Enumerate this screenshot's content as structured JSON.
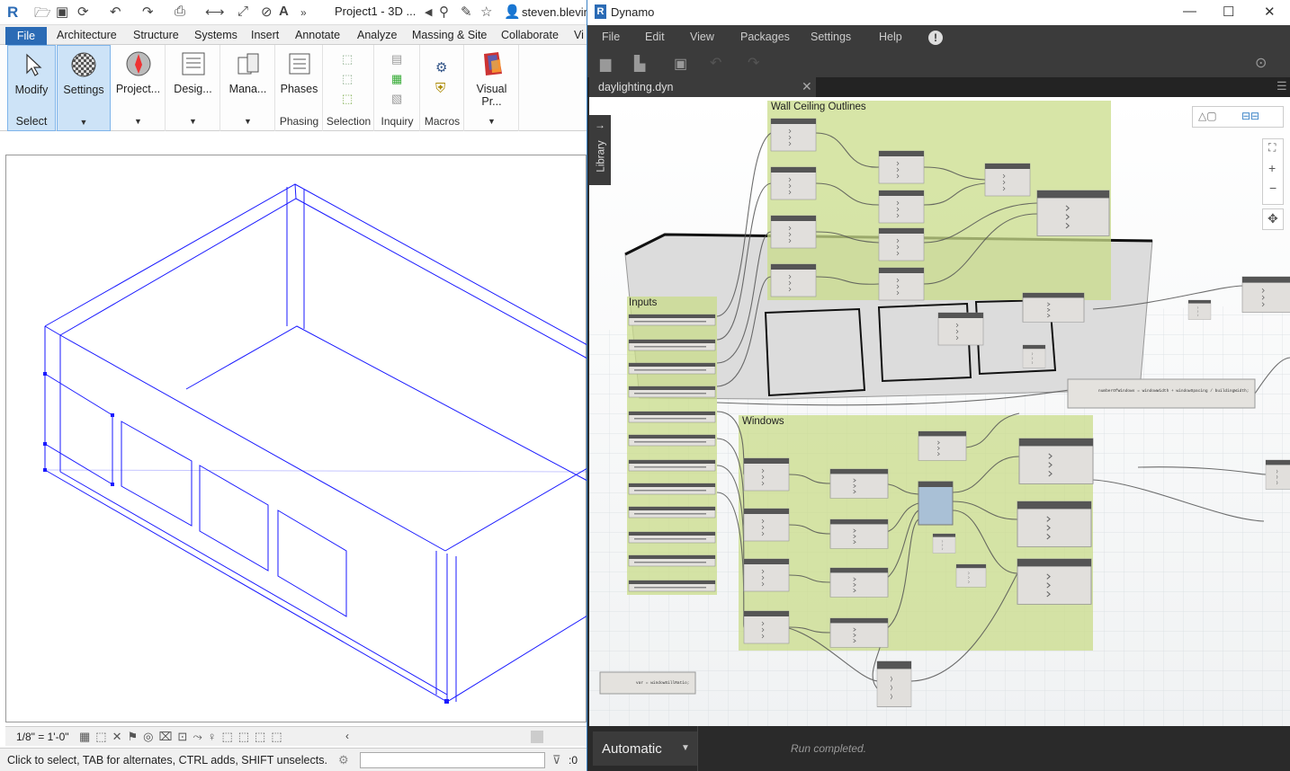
{
  "revit": {
    "window_title": "Project1 - 3D ...",
    "user": "steven.blevin",
    "tabs": [
      "File",
      "Architecture",
      "Structure",
      "Systems",
      "Insert",
      "Annotate",
      "Analyze",
      "Massing & Site",
      "Collaborate",
      "Vi"
    ],
    "ribbon": {
      "modify": "Modify",
      "select_panel": "Select",
      "settings": "Settings",
      "project": "Project...",
      "design": "Desig...",
      "manage": "Mana...",
      "phases": "Phases",
      "phasing_panel": "Phasing",
      "selection_panel": "Selection",
      "inquiry_panel": "Inquiry",
      "macros_panel": "Macros",
      "visual": "Visual Pr..."
    },
    "view_scale": "1/8\" = 1'-0\"",
    "status_text": "Click to select, TAB for alternates, CTRL adds, SHIFT unselects.",
    "filter_count": ":0"
  },
  "dynamo": {
    "title": "Dynamo",
    "menu": [
      "File",
      "Edit",
      "View",
      "Packages",
      "Settings",
      "Help"
    ],
    "tab_name": "daylighting.dyn",
    "library_label": "Library",
    "groups": {
      "wall": "Wall Ceiling Outlines",
      "inputs": "Inputs",
      "windows": "Windows"
    },
    "code_block_1": "numberOfWindows = windowWidth + windowSpacing / buildingWidth;",
    "code_block_2": "var = windowSillRatio;",
    "run_mode": "Automatic",
    "run_status": "Run completed."
  },
  "colors": {
    "revit_file_tab": "#2b6bb5",
    "dynamo_dark": "#2a2a2a",
    "group_green": "#c9dc8a",
    "model_line": "#1a1aff"
  }
}
